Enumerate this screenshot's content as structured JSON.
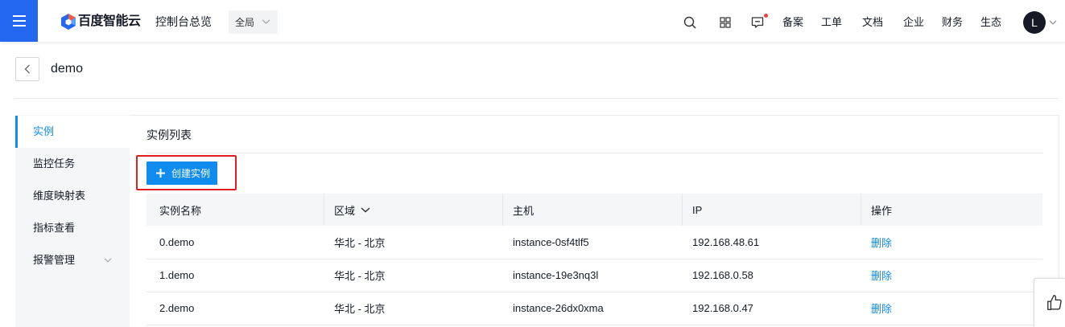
{
  "theme": {
    "brand_blue": "#2468f2",
    "accent": "#108cee",
    "highlight": "#e02020",
    "notice_dot": "#f33e3e",
    "avatar_bg": "#151b26"
  },
  "header": {
    "menu_icon": "menu-icon",
    "logo_icon": "baidu-cloud-logo-icon",
    "brand": "百度智能云",
    "console_link": "控制台总览",
    "scope_select": {
      "value": "全局",
      "icon": "chevron-down-icon"
    },
    "tools": [
      {
        "icon": "search-icon"
      },
      {
        "icon": "apps-grid-icon"
      },
      {
        "icon": "message-icon",
        "has_notice": true
      }
    ],
    "nav_links": [
      "备案",
      "工单",
      "文档",
      "企业",
      "财务",
      "生态"
    ],
    "avatar_initial": "L"
  },
  "page": {
    "back_icon": "chevron-left-icon",
    "title": "demo"
  },
  "sidebar": {
    "items": [
      {
        "label": "实例",
        "active": true
      },
      {
        "label": "监控任务",
        "active": false
      },
      {
        "label": "维度映射表",
        "active": false
      },
      {
        "label": "指标查看",
        "active": false
      },
      {
        "label": "报警管理",
        "active": false,
        "expandable": true
      }
    ]
  },
  "main": {
    "section_title": "实例列表",
    "create_button": {
      "label": "创建实例",
      "icon": "plus-icon"
    },
    "table": {
      "columns": [
        {
          "label": "实例名称"
        },
        {
          "label": "区域",
          "filter": true
        },
        {
          "label": "主机"
        },
        {
          "label": "IP"
        },
        {
          "label": "操作"
        }
      ],
      "rows": [
        {
          "name": "0.demo",
          "region": "华北 - 北京",
          "host": "instance-0sf4tlf5",
          "ip": "192.168.48.61",
          "action": "删除"
        },
        {
          "name": "1.demo",
          "region": "华北 - 北京",
          "host": "instance-19e3nq3l",
          "ip": "192.168.0.58",
          "action": "删除"
        },
        {
          "name": "2.demo",
          "region": "华北 - 北京",
          "host": "instance-26dx0xma",
          "ip": "192.168.0.47",
          "action": "删除"
        }
      ]
    }
  },
  "feedback": {
    "icon": "thumbs-up-icon"
  }
}
